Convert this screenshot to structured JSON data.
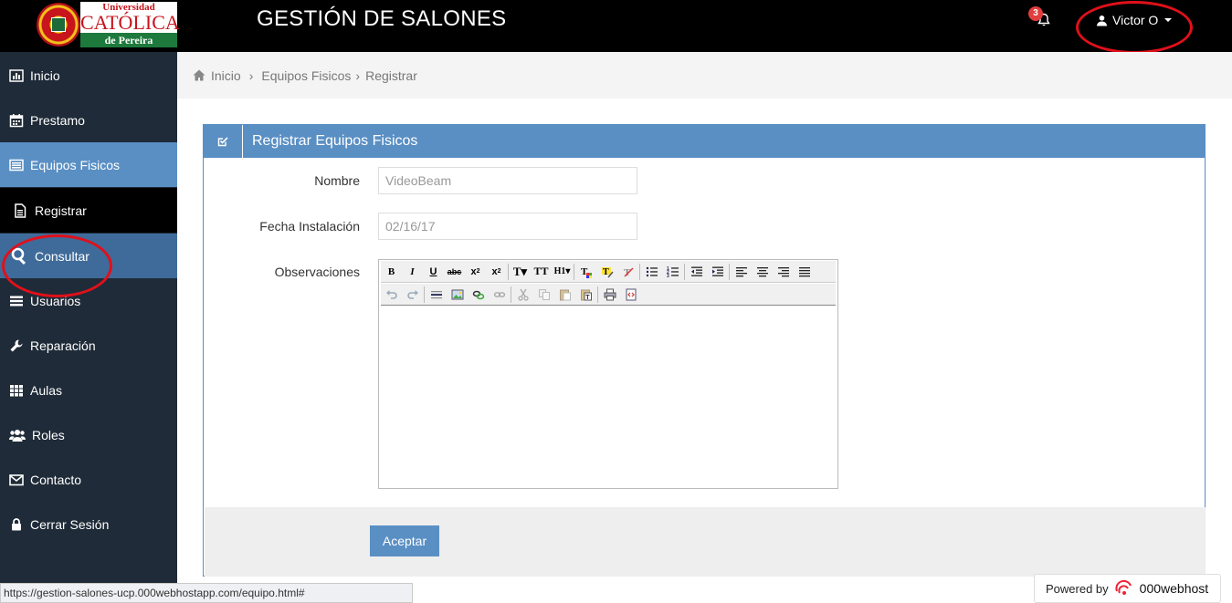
{
  "header": {
    "logo_line1": "Universidad",
    "logo_line2": "CATÓLICA",
    "logo_line3": "de Pereira",
    "title": "GESTIÓN DE SALONES",
    "notifications_count": "3",
    "user_name": "Victor O"
  },
  "sidebar": {
    "items": [
      {
        "label": "Inicio",
        "icon": "bar-chart-icon"
      },
      {
        "label": "Prestamo",
        "icon": "calendar-icon"
      },
      {
        "label": "Equipos Fisicos",
        "icon": "list-icon"
      },
      {
        "label": "Registrar",
        "icon": "file-icon"
      },
      {
        "label": "Consultar",
        "icon": "search-icon"
      },
      {
        "label": "Usuarios",
        "icon": "menu-icon"
      },
      {
        "label": "Reparación",
        "icon": "wrench-icon"
      },
      {
        "label": "Aulas",
        "icon": "grid-icon"
      },
      {
        "label": "Roles",
        "icon": "users-icon"
      },
      {
        "label": "Contacto",
        "icon": "envelope-icon"
      },
      {
        "label": "Cerrar Sesión",
        "icon": "lock-icon"
      }
    ]
  },
  "breadcrumb": {
    "items": [
      "Inicio",
      "Equipos Fisicos",
      "Registrar"
    ]
  },
  "panel": {
    "title": "Registrar Equipos Fisicos"
  },
  "form": {
    "nombre_label": "Nombre",
    "nombre_placeholder": "VideoBeam",
    "fecha_label": "Fecha Instalación",
    "fecha_placeholder": "02/16/17",
    "observaciones_label": "Observaciones",
    "accept_label": "Aceptar"
  },
  "status": {
    "url": "https://gestion-salones-ucp.000webhostapp.com/equipo.html#",
    "powered_by": "Powered by",
    "host_brand": "000webhost"
  },
  "colors": {
    "accent": "#5a8fc4",
    "sidebar": "#1f2b38",
    "annotation": "#e0101a"
  }
}
